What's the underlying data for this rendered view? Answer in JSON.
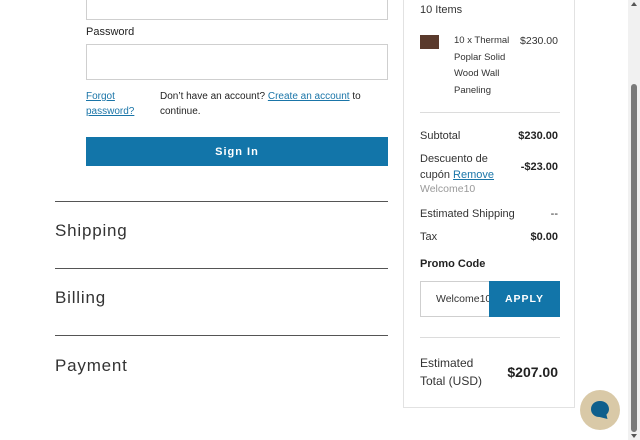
{
  "login": {
    "password_label": "Password",
    "forgot_label": "Forgot password?",
    "no_account_text": "Don’t have an account?",
    "create_account_label": "Create an account",
    "continue_text": "to continue.",
    "sign_in_label": "Sign In"
  },
  "sections": {
    "shipping": "Shipping",
    "billing": "Billing",
    "payment": "Payment"
  },
  "summary": {
    "items_count": "10 Items",
    "item": {
      "name": "10 x Thermal Poplar Solid Wood Wall Paneling",
      "price": "$230.00"
    },
    "subtotal_label": "Subtotal",
    "subtotal_value": "$230.00",
    "coupon_label": "Descuento de cupón",
    "coupon_remove": "Remove",
    "coupon_code": "Welcome10",
    "coupon_value": "-$23.00",
    "shipping_label": "Estimated Shipping",
    "shipping_value": "--",
    "tax_label": "Tax",
    "tax_value": "$0.00",
    "promo_title": "Promo Code",
    "promo_value": "Welcome10",
    "apply_label": "APPLY",
    "total_label": "Estimated Total (USD)",
    "total_value": "$207.00"
  },
  "colors": {
    "accent": "#1275a9",
    "link": "#1a75a8",
    "thumbnail": "#5a3a2c",
    "chat_button": "#d9c9a7",
    "chat_icon": "#0f5f8c"
  },
  "icons": {
    "chat": "chat-bubble-icon",
    "scroll_up": "arrow-up-icon",
    "scroll_down": "arrow-down-icon"
  }
}
